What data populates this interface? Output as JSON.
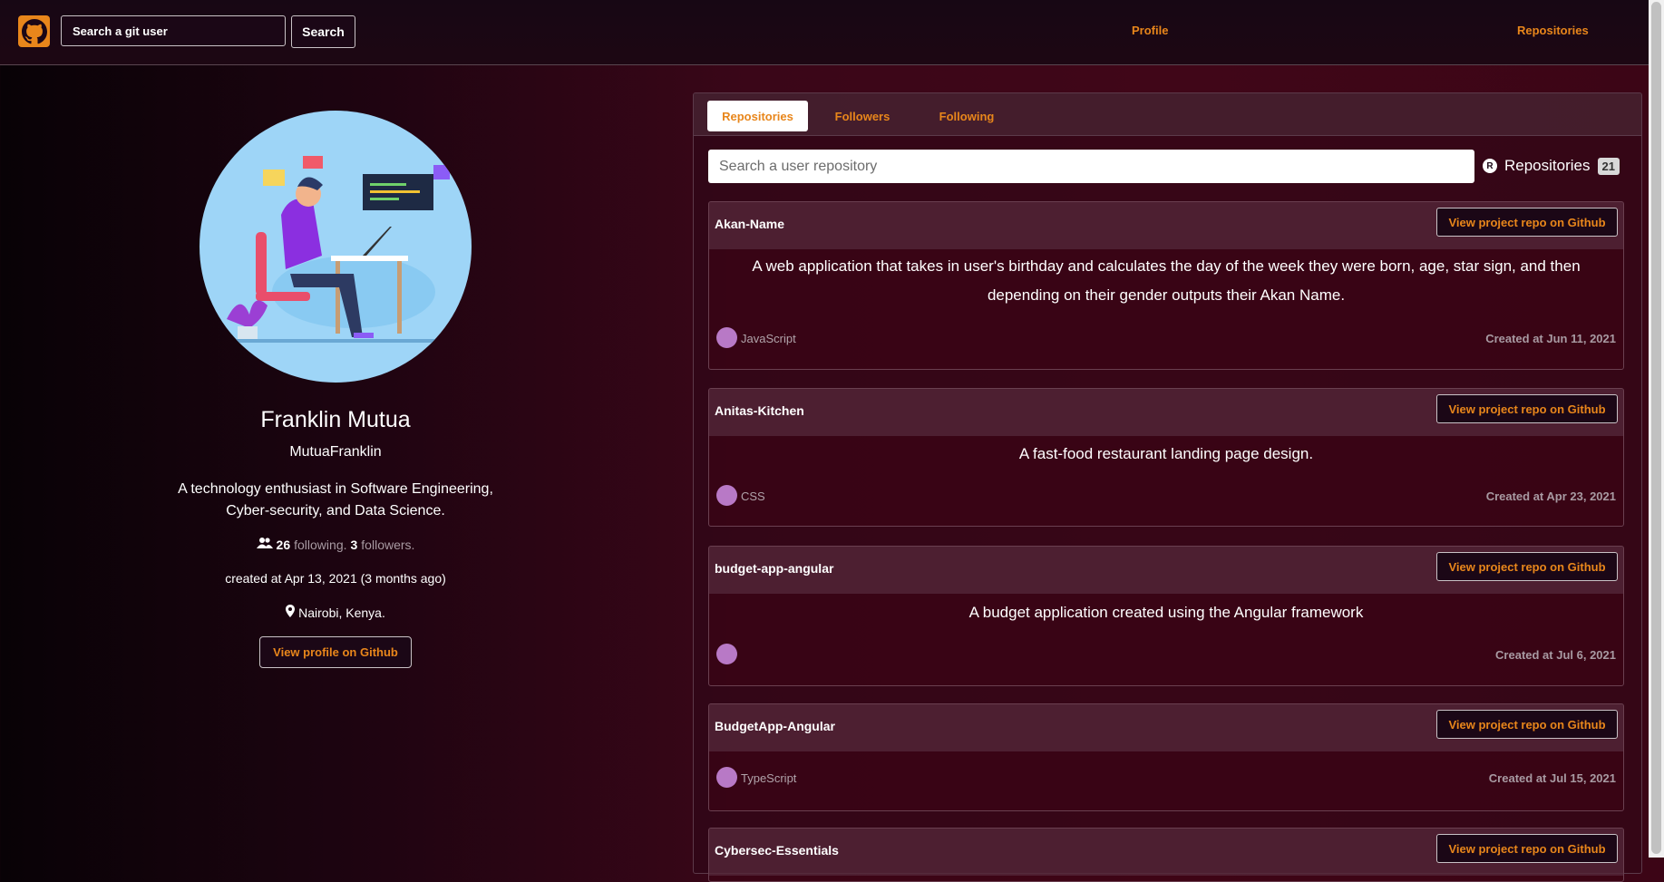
{
  "header": {
    "search_placeholder": "Search a git user",
    "search_button": "Search",
    "nav_profile": "Profile",
    "nav_repositories": "Repositories"
  },
  "profile": {
    "name": "Franklin Mutua",
    "login": "MutuaFranklin",
    "bio": "A technology enthusiast in Software Engineering, Cyber-security, and Data Science.",
    "following_count": "26",
    "following_label": "following.",
    "followers_count": "3",
    "followers_label": "followers.",
    "created": "created at Apr 13, 2021 (3 months ago)",
    "location": "Nairobi, Kenya.",
    "view_button": "View profile on Github"
  },
  "tabs": [
    "Repositories",
    "Followers",
    "Following"
  ],
  "repo_panel": {
    "search_placeholder": "Search a user repository",
    "count_label": "Repositories",
    "count": "21",
    "view_button": "View project repo on Github"
  },
  "repos": [
    {
      "name": "Akan-Name",
      "description": "A web application that takes in user's birthday and calculates the day of the week they were born, age, star sign, and then depending on their gender outputs their Akan Name.",
      "language": "JavaScript",
      "created": "Created at Jun 11, 2021"
    },
    {
      "name": "Anitas-Kitchen",
      "description": "A fast-food restaurant landing page design.",
      "language": "CSS",
      "created": "Created at Apr 23, 2021"
    },
    {
      "name": "budget-app-angular",
      "description": "A budget application created using the Angular framework",
      "language": "",
      "created": "Created at Jul 6, 2021"
    },
    {
      "name": "BudgetApp-Angular",
      "description": "",
      "language": "TypeScript",
      "created": "Created at Jul 15, 2021"
    },
    {
      "name": "Cybersec-Essentials",
      "description": "",
      "language": "",
      "created": ""
    }
  ],
  "colors": {
    "accent": "#e8861b",
    "lang_dot": "#b879c6"
  }
}
